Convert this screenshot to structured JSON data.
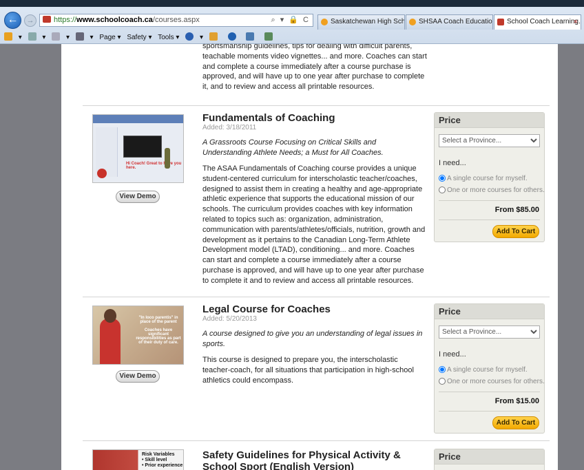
{
  "browser": {
    "url_scheme": "https://",
    "url_host": "www.schoolcoach.ca",
    "url_path": "/courses.aspx",
    "address_icons": "⌕ ▾ 🔒 C",
    "tabs": [
      {
        "label": "Saskatchewan High Schoo..."
      },
      {
        "label": "SHSAA Coach Education a..."
      },
      {
        "label": "School Coach Learning...",
        "active": true
      }
    ],
    "tab_close": "×",
    "back": "←",
    "forward": "→",
    "commands": {
      "page": "Page ▾",
      "safety": "Safety ▾",
      "tools": "Tools ▾"
    }
  },
  "top_text": "sportsmanship guidelines, tips for dealing with difficult parents, teachable moments video vignettes... and more. Coaches can start and complete a course immediately after a course purchase is approved, and will have up to one year after purchase to complete it, and to review and access all printable resources.",
  "courses": [
    {
      "title": "Fundamentals of Coaching",
      "added": "Added: 3/18/2011",
      "tagline": "A Grassroots Course Focusing on Critical Skills and Understanding Athlete Needs; a Must for All Coaches.",
      "description": "The ASAA Fundamentals of Coaching course provides a unique student-centered curriculum for interscholastic teacher/coaches, designed to assist them in creating a healthy and age-appropriate athletic experience that supports the educational mission of our schools. The curriculum provides coaches with key information related to topics such as: organization, administration, communication with parents/athletes/officials, nutrition, growth and development as it pertains to the Canadian Long-Term Athlete Development model (LTAD), conditioning... and more. Coaches can start and complete a course immediately after a course purchase is approved, and will have up to one year after purchase to complete it and to review and access all printable resources.",
      "demo_label": "View Demo",
      "thumb_caption": "Hi Coach! Great to have you here.",
      "price_heading": "Price",
      "province_placeholder": "Select a Province...",
      "need_label": "I need...",
      "option_single": "A single course for myself.",
      "option_multi": "One or more courses for others.",
      "price": "From $85.00",
      "cart_label": "Add To Cart"
    },
    {
      "title": "Legal Course for Coaches",
      "added": "Added: 5/20/2013",
      "tagline": "A course designed to give you an understanding of legal issues in sports.",
      "description": "This course is designed to prepare you, the interscholastic teacher-coach, for all situations that participation in high-school athletics could encompass.",
      "demo_label": "View Demo",
      "thumb_quote": "\"In loco parentis\" in place of the parent",
      "thumb_text": "Coaches have significant responsibilities as part of their duty of care.",
      "price_heading": "Price",
      "province_placeholder": "Select a Province...",
      "need_label": "I need...",
      "option_single": "A single course for myself.",
      "option_multi": "One or more courses for others.",
      "price": "From $15.00",
      "cart_label": "Add To Cart"
    },
    {
      "title": "Safety Guidelines for Physical Activity & School Sport (English Version)",
      "thumb_heading": "Risk Variables",
      "thumb_item1": "• Skill level",
      "thumb_item2": "• Prior experience",
      "price_heading": "Price"
    }
  ]
}
